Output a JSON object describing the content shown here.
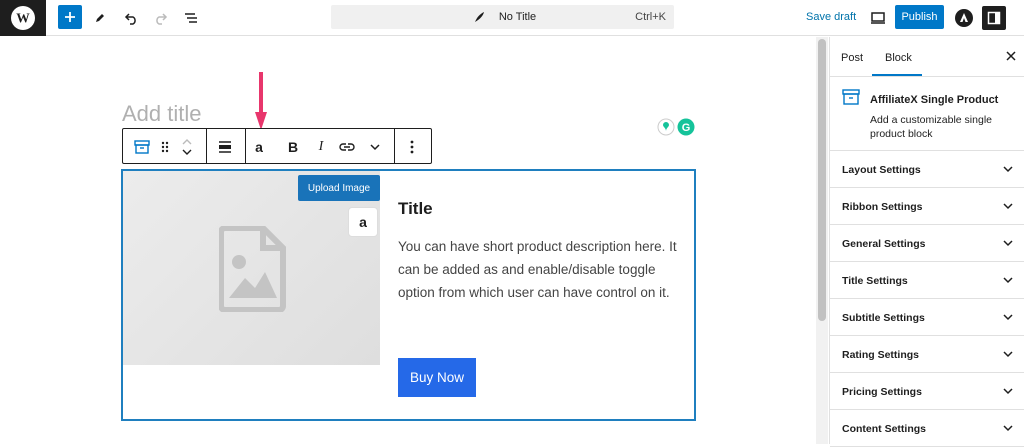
{
  "topbar": {
    "document_title": "No Title",
    "shortcut": "Ctrl+K",
    "save_draft_label": "Save draft",
    "publish_label": "Publish"
  },
  "editor": {
    "title_placeholder": "Add title"
  },
  "toolbar": {
    "amazon_label": "a",
    "bold_label": "B",
    "italic_label": "I"
  },
  "product_block": {
    "upload_label": "Upload Image",
    "amazon_badge": "a",
    "title": "Title",
    "description": "You can have short product description here. It can be added as and enable/disable toggle option from which user can have control on it.",
    "button_label": "Buy Now"
  },
  "sidebar": {
    "tabs": [
      "Post",
      "Block"
    ],
    "active_tab": "Block",
    "block_name": "AffiliateX Single Product",
    "block_description": "Add a customizable single product block",
    "panels": [
      "Layout Settings",
      "Ribbon Settings",
      "General Settings",
      "Title Settings",
      "Subtitle Settings",
      "Rating Settings",
      "Pricing Settings",
      "Content Settings"
    ]
  },
  "colors": {
    "accent": "#0078c8",
    "arrow": "#e8366c",
    "buy_button": "#2569e8",
    "block_border": "#1f7fbf"
  }
}
